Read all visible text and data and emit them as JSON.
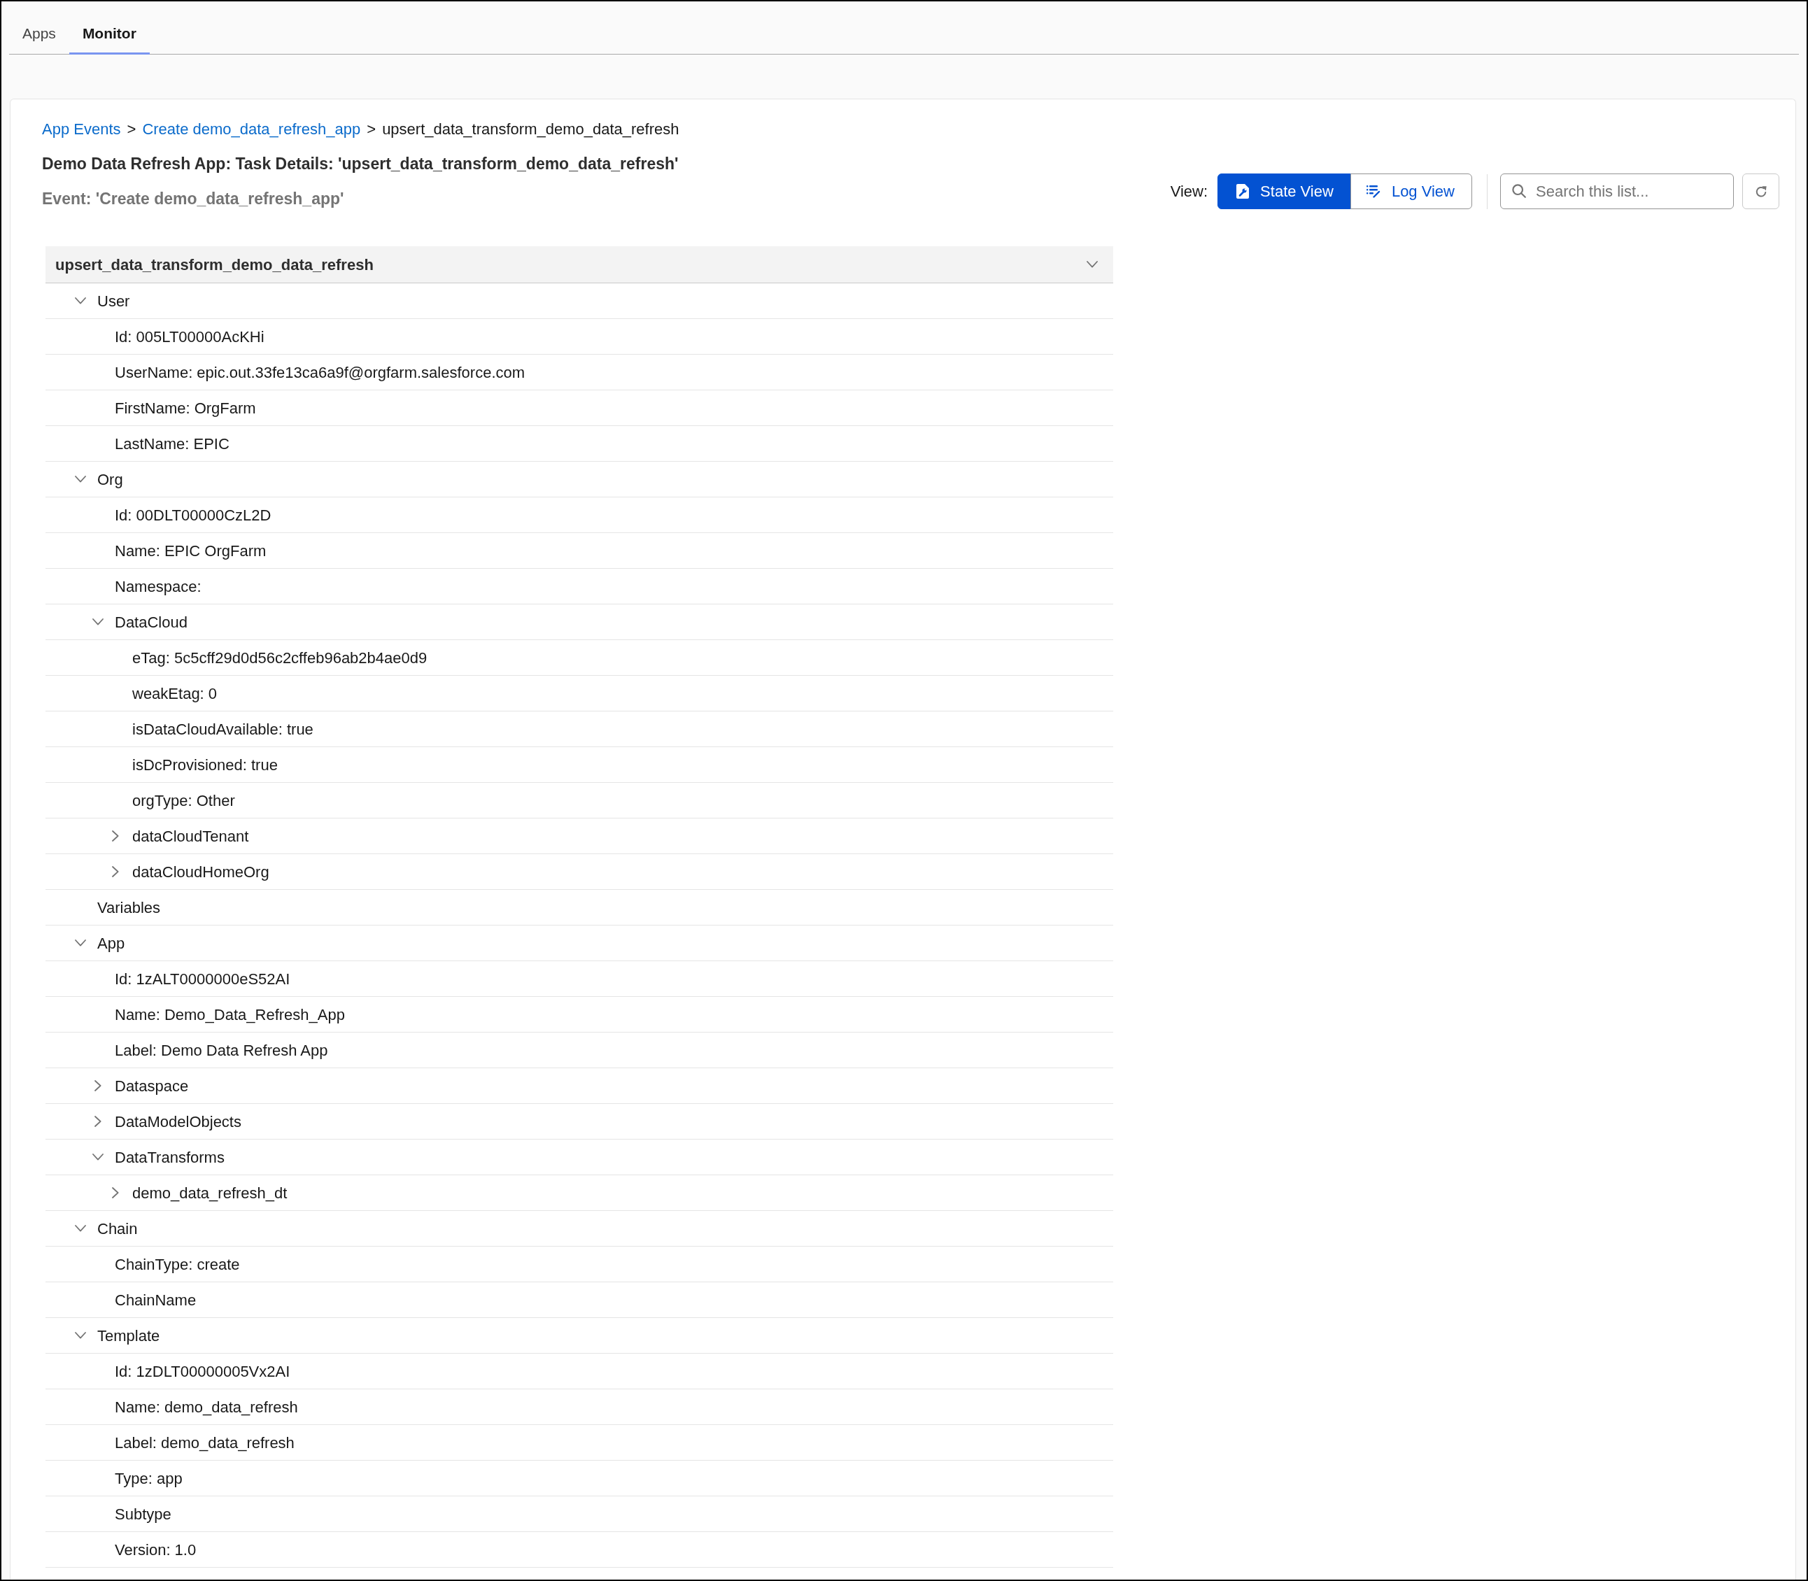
{
  "tabs": [
    {
      "label": "Apps",
      "selected": false
    },
    {
      "label": "Monitor",
      "selected": true
    }
  ],
  "breadcrumb": [
    {
      "kind": "link",
      "label": "App Events"
    },
    {
      "kind": "separator",
      "label": ">"
    },
    {
      "kind": "link",
      "label": "Create demo_data_refresh_app"
    },
    {
      "kind": "separator",
      "label": ">"
    },
    {
      "kind": "current",
      "label": "upsert_data_transform_demo_data_refresh"
    }
  ],
  "title": "Demo Data Refresh App: Task Details: 'upsert_data_transform_demo_data_refresh'",
  "subtitle": "Event: 'Create demo_data_refresh_app'",
  "view_switch": {
    "label": "View:",
    "options": [
      {
        "label": "State View",
        "selected": true
      },
      {
        "label": "Log View",
        "selected": false
      }
    ]
  },
  "search": {
    "placeholder": "Search this list..."
  },
  "tree": {
    "title": "upsert_data_transform_demo_data_refresh",
    "expanded": true,
    "items": [
      {
        "label": "User",
        "expanded": true,
        "children": [
          {
            "label": "Id: 005LT00000AcKHi"
          },
          {
            "label": "UserName: epic.out.33fe13ca6a9f@orgfarm.salesforce.com"
          },
          {
            "label": "FirstName: OrgFarm"
          },
          {
            "label": "LastName: EPIC"
          }
        ]
      },
      {
        "label": "Org",
        "expanded": true,
        "children": [
          {
            "label": "Id: 00DLT00000CzL2D"
          },
          {
            "label": "Name: EPIC OrgFarm"
          },
          {
            "label": "Namespace:"
          },
          {
            "label": "DataCloud",
            "expanded": true,
            "children": [
              {
                "label": "eTag: 5c5cff29d0d56c2cffeb96ab2b4ae0d9"
              },
              {
                "label": "weakEtag: 0"
              },
              {
                "label": "isDataCloudAvailable: true"
              },
              {
                "label": "isDcProvisioned: true"
              },
              {
                "label": "orgType: Other"
              },
              {
                "label": "dataCloudTenant",
                "expanded": false
              },
              {
                "label": "dataCloudHomeOrg",
                "expanded": false
              }
            ]
          }
        ]
      },
      {
        "label": "Variables"
      },
      {
        "label": "App",
        "expanded": true,
        "children": [
          {
            "label": "Id: 1zALT0000000eS52AI"
          },
          {
            "label": "Name: Demo_Data_Refresh_App"
          },
          {
            "label": "Label: Demo Data Refresh App"
          },
          {
            "label": "Dataspace",
            "expanded": false
          },
          {
            "label": "DataModelObjects",
            "expanded": false
          },
          {
            "label": "DataTransforms",
            "expanded": true,
            "children": [
              {
                "label": "demo_data_refresh_dt",
                "expanded": false
              }
            ]
          }
        ]
      },
      {
        "label": "Chain",
        "expanded": true,
        "children": [
          {
            "label": "ChainType: create"
          },
          {
            "label": "ChainName"
          }
        ]
      },
      {
        "label": "Template",
        "expanded": true,
        "children": [
          {
            "label": "Id: 1zDLT00000005Vx2AI"
          },
          {
            "label": "Name: demo_data_refresh"
          },
          {
            "label": "Label: demo_data_refresh"
          },
          {
            "label": "Type: app"
          },
          {
            "label": "Subtype"
          },
          {
            "label": "Version: 1.0"
          }
        ]
      }
    ]
  }
}
